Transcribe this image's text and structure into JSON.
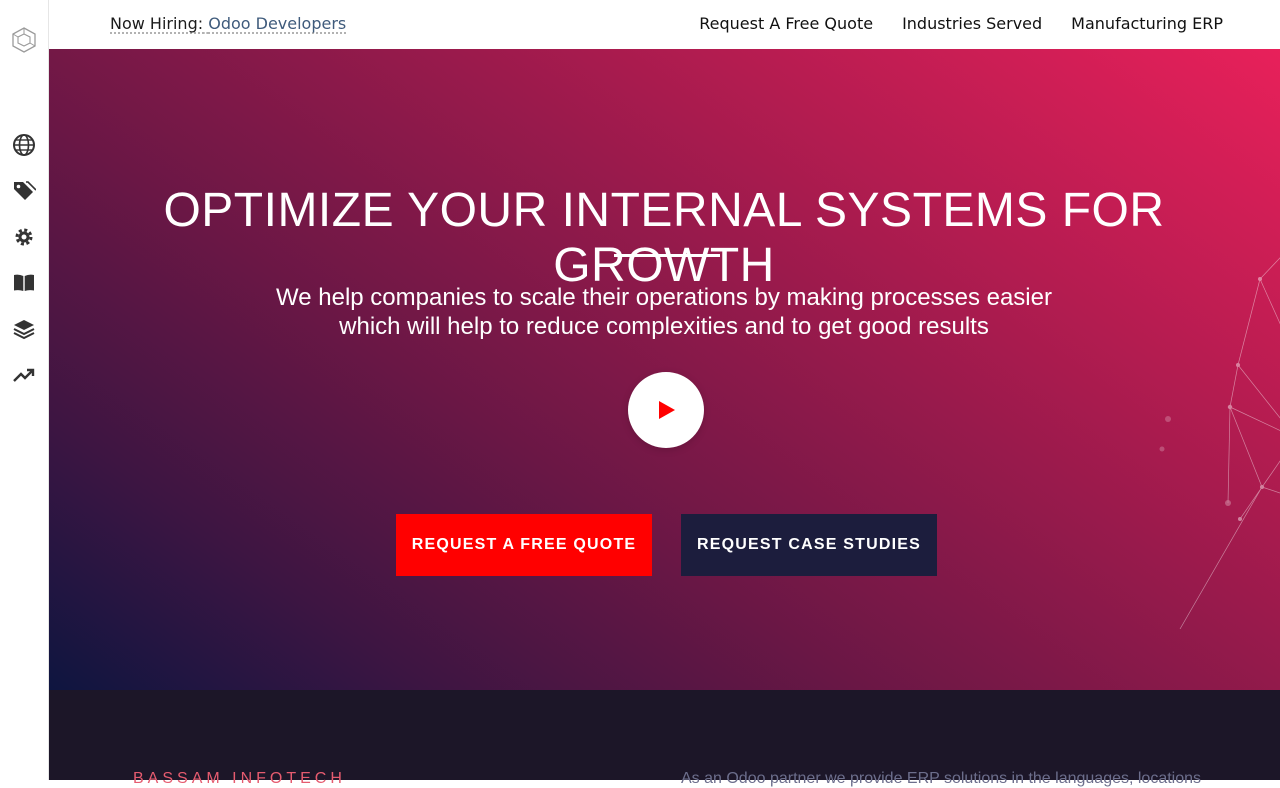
{
  "topbar": {
    "hiring_label": "Now Hiring:",
    "hiring_role": "Odoo Developers",
    "nav": [
      "Request A Free Quote",
      "Industries Served",
      "Manufacturing ERP"
    ]
  },
  "sidebar": {
    "icons": [
      "globe-icon",
      "tag-icon",
      "gear-icon",
      "book-icon",
      "layers-icon",
      "trending-up-icon"
    ]
  },
  "hero": {
    "title": "OPTIMIZE YOUR INTERNAL SYSTEMS FOR GROWTH",
    "subtitle_line1": "We help companies to scale their operations by making processes easier",
    "subtitle_line2": "which will help to reduce complexities and to get good results",
    "cta_primary": "REQUEST A FREE QUOTE",
    "cta_secondary": "REQUEST CASE STUDIES"
  },
  "bottom": {
    "brand": "BASSAM INFOTECH",
    "partner_text": "As an Odoo partner we provide ERP solutions in the languages, locations"
  },
  "colors": {
    "cta_primary": "#ff0000",
    "cta_secondary": "#1c1d3d",
    "hero_gradient_start": "#0e1540",
    "hero_gradient_end": "#e8205a",
    "bottom_bg": "#1c1628"
  }
}
